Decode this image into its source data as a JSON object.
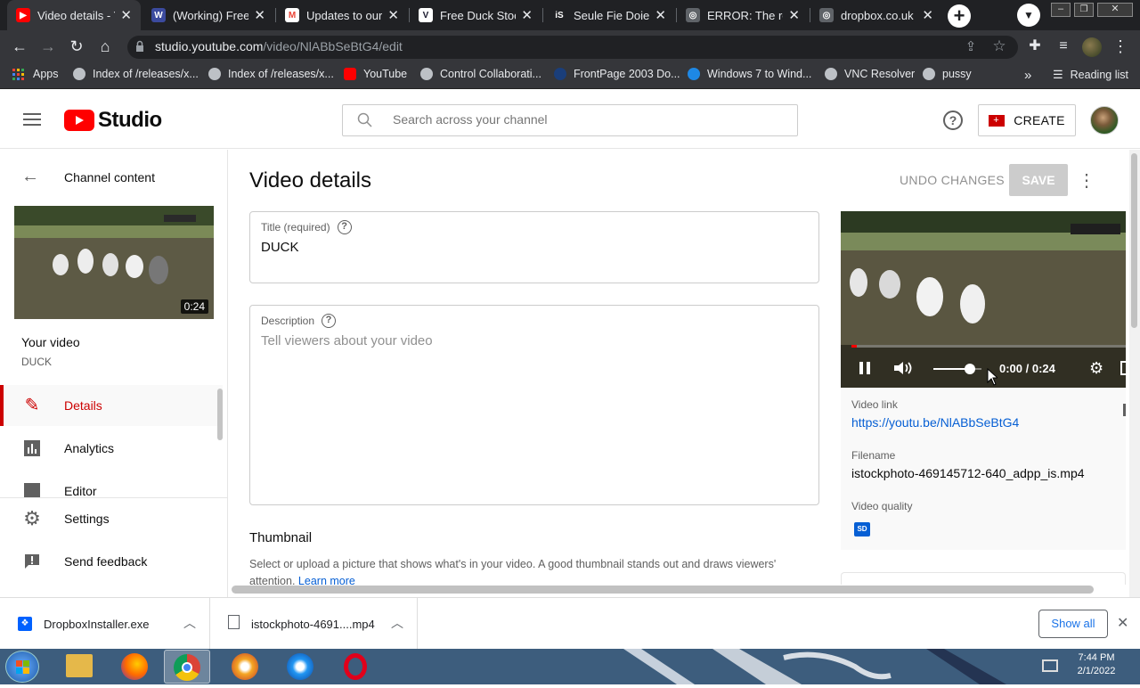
{
  "browser": {
    "tabs": [
      {
        "title": "Video details - Y",
        "fav_color": "#ff0000",
        "fav_char": "▶"
      },
      {
        "title": "(Working) Free V",
        "fav_color": "#3b4a9e",
        "fav_char": "W"
      },
      {
        "title": "Updates to our",
        "fav_color": "#ea4335",
        "fav_char": "M"
      },
      {
        "title": "Free Duck Stock",
        "fav_color": "#1a1a2e",
        "fav_char": "V"
      },
      {
        "title": "Seule Fie Doies",
        "fav_color": "#202124",
        "fav_char": "iS"
      },
      {
        "title": "ERROR: The req",
        "fav_color": "#5f6368",
        "fav_char": "◎"
      },
      {
        "title": "dropbox.co.uk",
        "fav_color": "#5f6368",
        "fav_char": "◎"
      }
    ],
    "url_host": "studio.youtube.com",
    "url_path": "/video/NlABbSeBtG4/edit",
    "bookmarks": [
      {
        "label": "Apps",
        "color": "#4285f4"
      },
      {
        "label": "Index of /releases/x...",
        "color": "#bdc1c6"
      },
      {
        "label": "Index of /releases/x...",
        "color": "#bdc1c6"
      },
      {
        "label": "YouTube",
        "color": "#ff0000"
      },
      {
        "label": "Control Collaborati...",
        "color": "#bdc1c6"
      },
      {
        "label": "FrontPage 2003 Do...",
        "color": "#1a3e7a"
      },
      {
        "label": "Windows 7 to Wind...",
        "color": "#1e88e5"
      },
      {
        "label": "VNC Resolver",
        "color": "#bdc1c6"
      },
      {
        "label": "pussy",
        "color": "#bdc1c6"
      }
    ],
    "more_bookmarks": "»",
    "reading_list": "Reading list"
  },
  "studio": {
    "logo_text": "Studio",
    "search_placeholder": "Search across your channel",
    "create_label": "CREATE"
  },
  "sidebar": {
    "back_label": "Channel content",
    "thumb_duration": "0:24",
    "your_video_label": "Your video",
    "video_title": "DUCK",
    "nav": [
      {
        "label": "Details",
        "icon": "pencil-icon",
        "active": true
      },
      {
        "label": "Analytics",
        "icon": "analytics-icon",
        "active": false
      },
      {
        "label": "Editor",
        "icon": "editor-icon",
        "active": false
      }
    ],
    "settings_label": "Settings",
    "feedback_label": "Send feedback"
  },
  "main": {
    "page_title": "Video details",
    "undo_label": "UNDO CHANGES",
    "save_label": "SAVE",
    "title_label": "Title (required)",
    "title_value": "DUCK",
    "description_label": "Description",
    "description_placeholder": "Tell viewers about your video",
    "thumbnail_heading": "Thumbnail",
    "thumbnail_text": "Select or upload a picture that shows what's in your video. A good thumbnail stands out and draws viewers'",
    "thumbnail_text2": "attention.",
    "learn_more": "Learn more"
  },
  "player": {
    "time": "0:00 / 0:24",
    "progress": 0.02,
    "volume": 0.75
  },
  "details_panel": {
    "video_link_label": "Video link",
    "video_link": "https://youtu.be/NlABbSeBtG4",
    "filename_label": "Filename",
    "filename": "istockphoto-469145712-640_adpp_is.mp4",
    "quality_label": "Video quality",
    "quality_badge": "SD"
  },
  "downloads": {
    "items": [
      {
        "name": "DropboxInstaller.exe"
      },
      {
        "name": "istockphoto-4691....mp4"
      }
    ],
    "show_all": "Show all"
  },
  "taskbar": {
    "time": "7:44 PM",
    "date": "2/1/2022"
  }
}
